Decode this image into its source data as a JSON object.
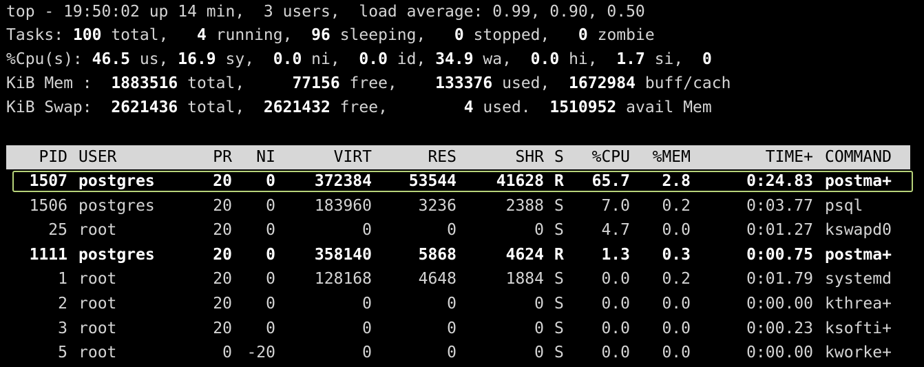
{
  "summary": {
    "line1": "top - 19:50:02 up 14 min,  3 users,  load average: 0.99, 0.90, 0.50",
    "line2": {
      "p0": "Tasks: ",
      "v0": "100",
      "p1": " total,   ",
      "v1": "4",
      "p2": " running,  ",
      "v2": "96",
      "p3": " sleeping,   ",
      "v3": "0",
      "p4": " stopped,   ",
      "v4": "0",
      "p5": " zombie"
    },
    "line3": {
      "p0": "%Cpu(s): ",
      "v0": "46.5",
      "p1": " us, ",
      "v1": "16.9",
      "p2": " sy,  ",
      "v2": "0.0",
      "p3": " ni,  ",
      "v3": "0.0",
      "p4": " id, ",
      "v4": "34.9",
      "p5": " wa,  ",
      "v5": "0.0",
      "p6": " hi,  ",
      "v6": "1.7",
      "p7": " si,  ",
      "v7": "0"
    },
    "line4": {
      "p0": "KiB Mem :  ",
      "v0": "1883516",
      "p1": " total,     ",
      "v1": "77156",
      "p2": " free,    ",
      "v2": "133376",
      "p3": " used,  ",
      "v3": "1672984",
      "p4": " buff/cach"
    },
    "line5": {
      "p0": "KiB Swap:  ",
      "v0": "2621436",
      "p1": " total,  ",
      "v1": "2621432",
      "p2": " free,        ",
      "v2": "4",
      "p3": " used.  ",
      "v3": "1510952",
      "p4": " avail Mem"
    }
  },
  "columns": {
    "pid": "PID",
    "user": "USER",
    "pr": "PR",
    "ni": "NI",
    "virt": "VIRT",
    "res": "RES",
    "shr": "SHR",
    "s": "S",
    "cpu": "%CPU",
    "mem": "%MEM",
    "time": "TIME+",
    "command": "COMMAND"
  },
  "processes": [
    {
      "pid": "1507",
      "user": "postgres",
      "pr": "20",
      "ni": "0",
      "virt": "372384",
      "res": "53544",
      "shr": "41628",
      "s": "R",
      "cpu": "65.7",
      "mem": "2.8",
      "time": "0:24.83",
      "command": "postma+"
    },
    {
      "pid": "1506",
      "user": "postgres",
      "pr": "20",
      "ni": "0",
      "virt": "183960",
      "res": "3236",
      "shr": "2388",
      "s": "S",
      "cpu": "7.0",
      "mem": "0.2",
      "time": "0:03.77",
      "command": "psql"
    },
    {
      "pid": "25",
      "user": "root",
      "pr": "20",
      "ni": "0",
      "virt": "0",
      "res": "0",
      "shr": "0",
      "s": "S",
      "cpu": "4.7",
      "mem": "0.0",
      "time": "0:01.27",
      "command": "kswapd0"
    },
    {
      "pid": "1111",
      "user": "postgres",
      "pr": "20",
      "ni": "0",
      "virt": "358140",
      "res": "5868",
      "shr": "4624",
      "s": "R",
      "cpu": "1.3",
      "mem": "0.3",
      "time": "0:00.75",
      "command": "postma+"
    },
    {
      "pid": "1",
      "user": "root",
      "pr": "20",
      "ni": "0",
      "virt": "128168",
      "res": "4648",
      "shr": "1884",
      "s": "S",
      "cpu": "0.0",
      "mem": "0.2",
      "time": "0:01.79",
      "command": "systemd"
    },
    {
      "pid": "2",
      "user": "root",
      "pr": "20",
      "ni": "0",
      "virt": "0",
      "res": "0",
      "shr": "0",
      "s": "S",
      "cpu": "0.0",
      "mem": "0.0",
      "time": "0:00.00",
      "command": "kthrea+"
    },
    {
      "pid": "3",
      "user": "root",
      "pr": "20",
      "ni": "0",
      "virt": "0",
      "res": "0",
      "shr": "0",
      "s": "S",
      "cpu": "0.0",
      "mem": "0.0",
      "time": "0:00.23",
      "command": "ksofti+"
    },
    {
      "pid": "5",
      "user": "root",
      "pr": "0",
      "ni": "-20",
      "virt": "0",
      "res": "0",
      "shr": "0",
      "s": "S",
      "cpu": "0.0",
      "mem": "0.0",
      "time": "0:00.00",
      "command": "kworke+"
    }
  ],
  "colors": {
    "background": "#000000",
    "text": "#d4d4d4",
    "bold_text": "#ffffff",
    "header_bg": "#d7d7d7",
    "highlight_border": "#b7d37a"
  }
}
